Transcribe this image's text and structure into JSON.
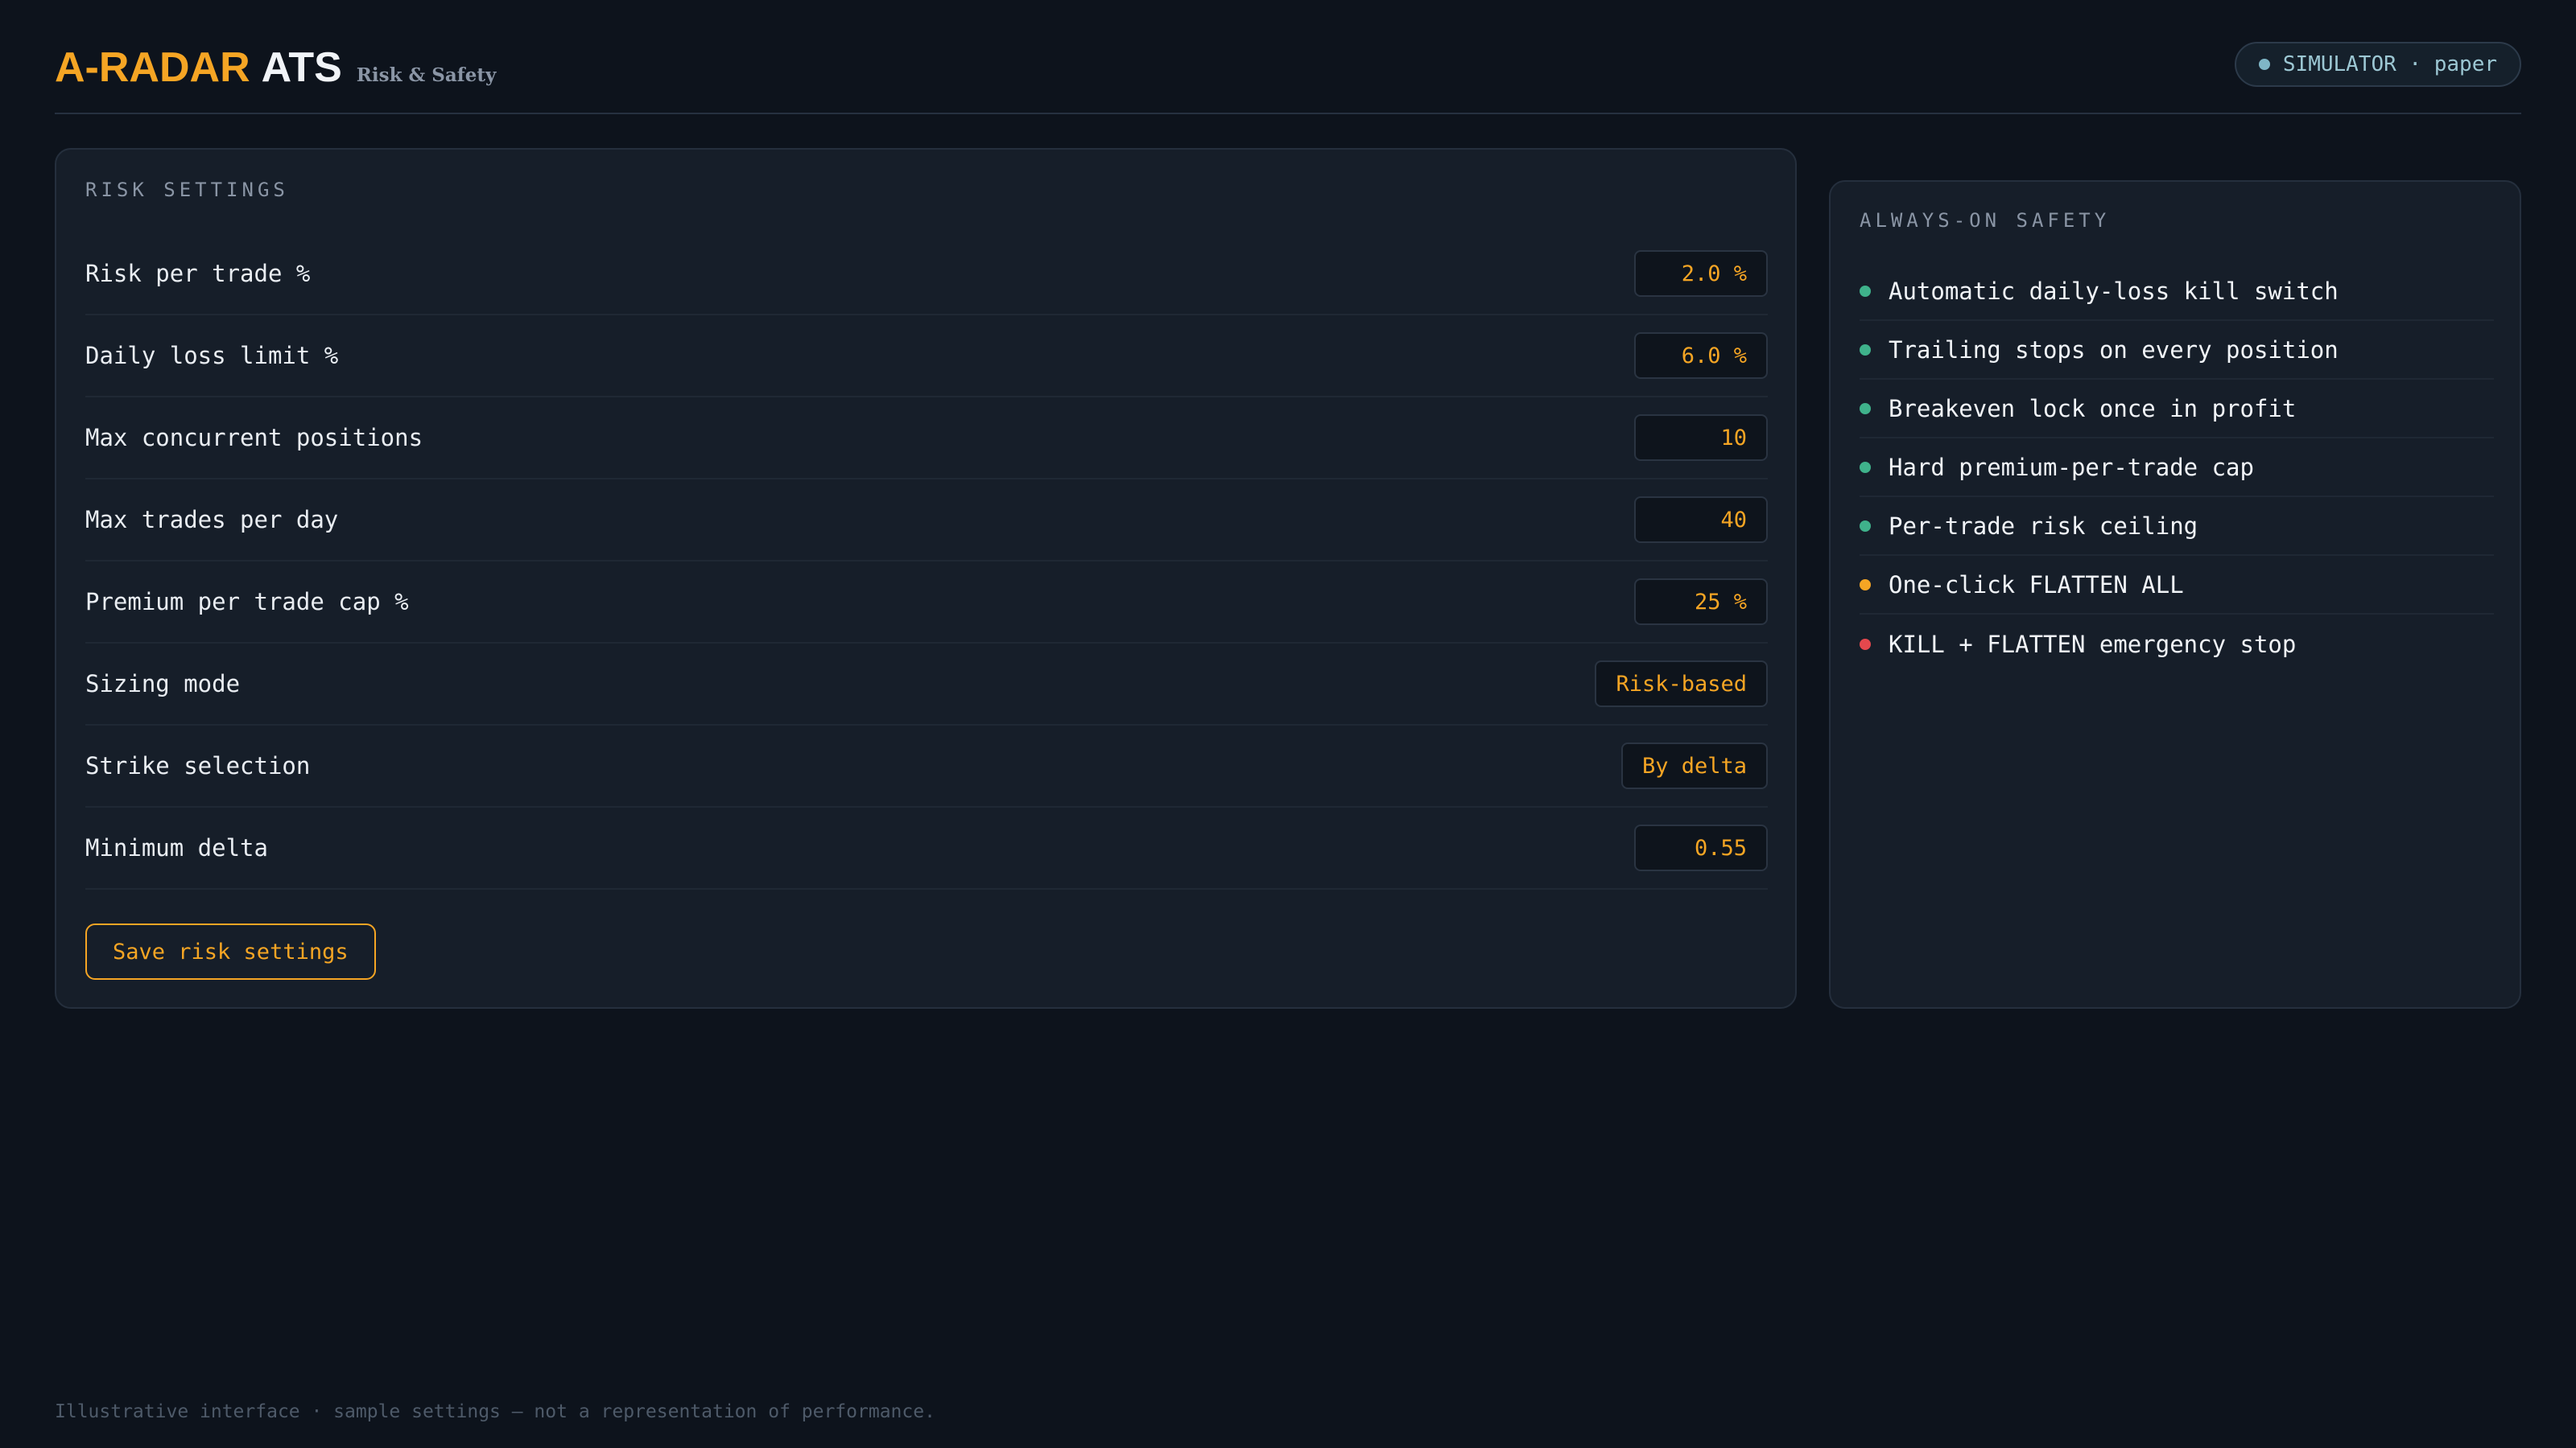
{
  "header": {
    "brand_primary": "A-RADAR",
    "brand_secondary": "ATS",
    "subtitle": "Risk & Safety",
    "mode": {
      "text": "SIMULATOR · paper",
      "dot_icon": "status-dot-icon",
      "color": "#7fb6c6"
    }
  },
  "risk": {
    "title": "RISK SETTINGS",
    "rows": [
      {
        "label": "Risk per trade %",
        "value": "2.0 %"
      },
      {
        "label": "Daily loss limit %",
        "value": "6.0 %"
      },
      {
        "label": "Max concurrent positions",
        "value": "10"
      },
      {
        "label": "Max trades per day",
        "value": "40"
      },
      {
        "label": "Premium per trade cap %",
        "value": "25 %"
      },
      {
        "label": "Sizing mode",
        "value": "Risk-based"
      },
      {
        "label": "Strike selection",
        "value": "By delta"
      },
      {
        "label": "Minimum delta",
        "value": "0.55"
      }
    ],
    "save_label": "Save risk settings"
  },
  "safety": {
    "title": "ALWAYS-ON SAFETY",
    "items": [
      {
        "text": "Automatic daily-loss kill switch",
        "color": "#3fb28b"
      },
      {
        "text": "Trailing stops on every position",
        "color": "#3fb28b"
      },
      {
        "text": "Breakeven lock once in profit",
        "color": "#3fb28b"
      },
      {
        "text": "Hard premium-per-trade cap",
        "color": "#3fb28b"
      },
      {
        "text": "Per-trade risk ceiling",
        "color": "#3fb28b"
      },
      {
        "text": "One-click FLATTEN ALL",
        "color": "#f5a524"
      },
      {
        "text": "KILL + FLATTEN emergency stop",
        "color": "#e5484d"
      }
    ]
  },
  "footer": {
    "disclaimer": "Illustrative interface · sample settings — not a representation of performance."
  },
  "colors": {
    "accent": "#f5a524",
    "background": "#0d131c",
    "card": "#161e29",
    "ok": "#3fb28b",
    "warn": "#f5a524",
    "danger": "#e5484d"
  }
}
